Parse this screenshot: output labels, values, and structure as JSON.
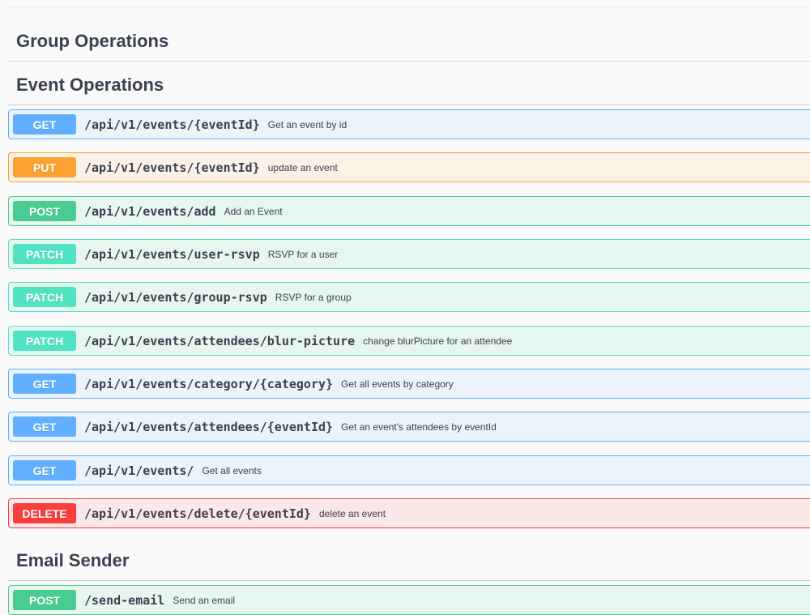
{
  "sections": {
    "group": {
      "title": "Group Operations"
    },
    "event": {
      "title": "Event Operations"
    },
    "email": {
      "title": "Email Sender"
    }
  },
  "event_ops": [
    {
      "method": "GET",
      "path": "/api/v1/events/{eventId}",
      "summary": "Get an event by id"
    },
    {
      "method": "PUT",
      "path": "/api/v1/events/{eventId}",
      "summary": "update an event"
    },
    {
      "method": "POST",
      "path": "/api/v1/events/add",
      "summary": "Add an Event"
    },
    {
      "method": "PATCH",
      "path": "/api/v1/events/user-rsvp",
      "summary": "RSVP for a user"
    },
    {
      "method": "PATCH",
      "path": "/api/v1/events/group-rsvp",
      "summary": "RSVP for a group"
    },
    {
      "method": "PATCH",
      "path": "/api/v1/events/attendees/blur-picture",
      "summary": "change blurPicture for an attendee"
    },
    {
      "method": "GET",
      "path": "/api/v1/events/category/{category}",
      "summary": "Get all events by category"
    },
    {
      "method": "GET",
      "path": "/api/v1/events/attendees/{eventId}",
      "summary": "Get an event's attendees by eventId"
    },
    {
      "method": "GET",
      "path": "/api/v1/events/",
      "summary": "Get all events"
    },
    {
      "method": "DELETE",
      "path": "/api/v1/events/delete/{eventId}",
      "summary": "delete an event"
    }
  ],
  "email_ops": [
    {
      "method": "POST",
      "path": "/send-email",
      "summary": "Send an email"
    }
  ],
  "colors": {
    "GET": "#61affe",
    "PUT": "#fca130",
    "POST": "#49cc90",
    "PATCH": "#50e3c2",
    "DELETE": "#f93e3e"
  }
}
